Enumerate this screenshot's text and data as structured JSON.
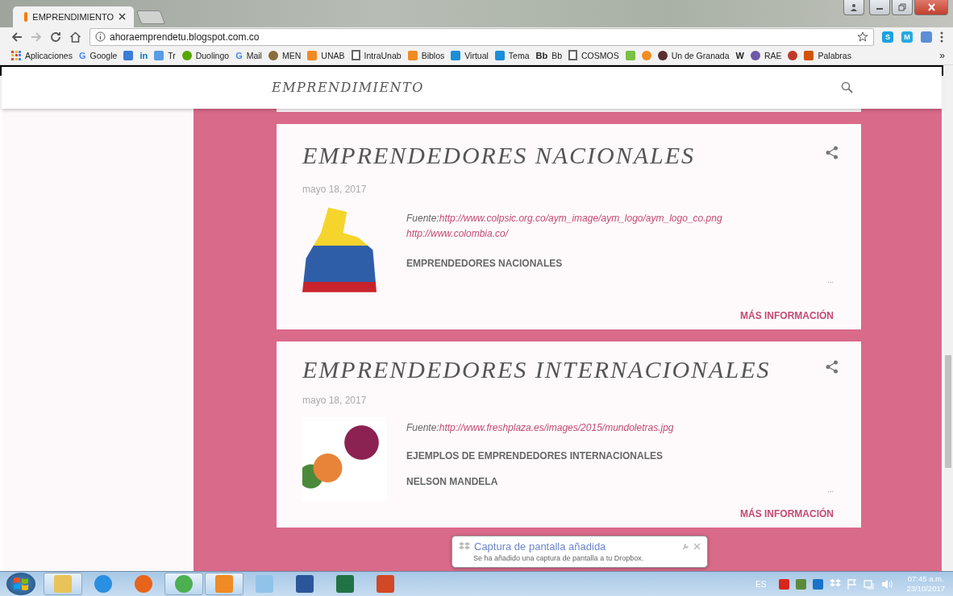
{
  "browser": {
    "tabs": [
      {
        "title": "EMPRENDIMIENTO",
        "selected": true
      }
    ],
    "address": "ahoraemprendetu.blogspot.com.co",
    "extensions": [
      {
        "label": "S",
        "color": "#1ba1e2"
      },
      {
        "label": "M",
        "color": "#29a8e0"
      },
      {
        "color": "#5b8fd6"
      }
    ],
    "bookmarks": [
      {
        "label": "Aplicaciones",
        "kind": "apps",
        "color": "#e94235"
      },
      {
        "label": "Google",
        "kind": "letter",
        "glyph": "G",
        "color": "#4285f4"
      },
      {
        "kind": "square",
        "color": "#3b7dd8"
      },
      {
        "kind": "letter",
        "glyph": "in",
        "color": "#0077b5"
      },
      {
        "label": "Tr",
        "kind": "square",
        "color": "#5a9be6"
      },
      {
        "label": "Duolingo",
        "kind": "seal",
        "color": "#58a700"
      },
      {
        "label": "Mail",
        "kind": "letter",
        "glyph": "G",
        "color": "#4285f4"
      },
      {
        "label": "MEN",
        "kind": "seal",
        "color": "#8a6d3b"
      },
      {
        "label": "UNAB",
        "kind": "square",
        "color": "#f08a24"
      },
      {
        "label": "IntraUnab",
        "kind": "page",
        "color": "#666666"
      },
      {
        "label": "Biblos",
        "kind": "square",
        "color": "#f08a24"
      },
      {
        "label": "Virtual",
        "kind": "square",
        "color": "#1c8ed8"
      },
      {
        "label": "Tema",
        "kind": "square",
        "color": "#1c8ed8"
      },
      {
        "label": "Bb",
        "kind": "letter",
        "glyph": "Bb",
        "color": "#222222"
      },
      {
        "label": "COSMOS",
        "kind": "page",
        "color": "#666666"
      },
      {
        "kind": "square",
        "color": "#7ac143"
      },
      {
        "kind": "seal",
        "color": "#f28c1e"
      },
      {
        "label": "Un de Granada",
        "kind": "seal",
        "color": "#5a2e2e"
      },
      {
        "kind": "letter",
        "glyph": "W",
        "color": "#222222"
      },
      {
        "label": "RAE",
        "kind": "seal",
        "color": "#6b5ba8"
      },
      {
        "kind": "seal",
        "color": "#c0392b"
      },
      {
        "label": "Palabras",
        "kind": "square",
        "color": "#d35400"
      }
    ],
    "more": "»"
  },
  "blog": {
    "title": "EMPRENDIMIENTO",
    "posts": [
      {
        "title": "EMPRENDEDORES NACIONALES",
        "date": "mayo 18, 2017",
        "kind": "flag",
        "source": "Fuente:",
        "links": [
          "http://www.colpsic.org.co/aym_image/aym_logo/aym_logo_co.png",
          "http://www.colombia.co/"
        ],
        "paragraphs": [
          "EMPRENDEDORES NACIONALES"
        ],
        "ellipsis": "...",
        "more": "MÁS INFORMACIÓN"
      },
      {
        "title": "EMPRENDEDORES INTERNACIONALES",
        "date": "mayo 18, 2017",
        "kind": "words",
        "source": "Fuente:",
        "links": [
          "http://www.freshplaza.es/images/2015/mundoletras.jpg"
        ],
        "paragraphs": [
          "EJEMPLOS DE EMPRENDEDORES INTERNACIONALES",
          "NELSON MANDELA"
        ],
        "ellipsis": "...",
        "more": "MÁS INFORMACIÓN"
      }
    ]
  },
  "notification": {
    "title": "Captura de pantalla añadida",
    "message": "Se ha añadido una captura de pantalla a tu Dropbox."
  },
  "taskbar": {
    "apps": [
      {
        "kind": "folder",
        "running": true
      },
      {
        "kind": "ie",
        "running": false
      },
      {
        "kind": "firefox",
        "running": false
      },
      {
        "kind": "chrome",
        "running": true
      },
      {
        "kind": "media",
        "running": true
      },
      {
        "kind": "notepad",
        "running": false
      },
      {
        "kind": "word",
        "running": false
      },
      {
        "kind": "excel",
        "running": false
      },
      {
        "kind": "powerpoint",
        "running": false
      }
    ],
    "language": "ES",
    "time": "07:45 a.m.",
    "date": "23/10/2017"
  }
}
